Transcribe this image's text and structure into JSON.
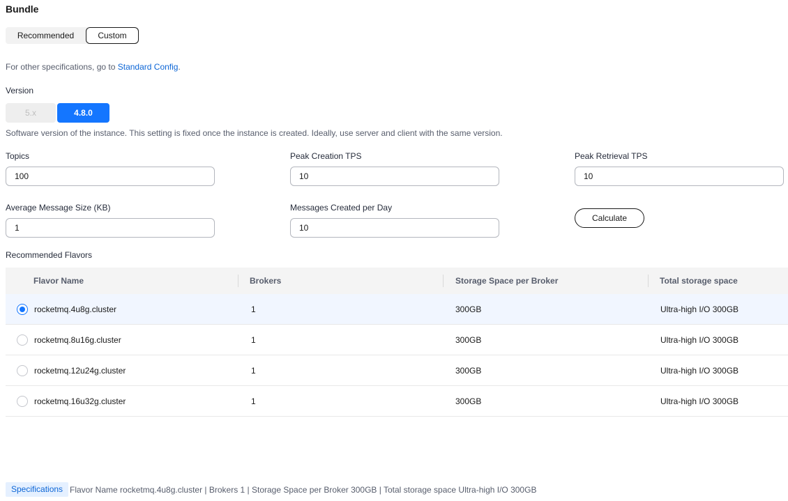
{
  "bundle": {
    "title": "Bundle",
    "tabs": {
      "recommended": "Recommended",
      "custom": "Custom"
    }
  },
  "note": {
    "prefix": "For other specifications, go to ",
    "link": "Standard Config",
    "suffix": "."
  },
  "version": {
    "label": "Version",
    "options": [
      "5.x",
      "4.8.0"
    ],
    "selected": "4.8.0",
    "hint": "Software version of the instance. This setting is fixed once the instance is created. Ideally, use server and client with the same version."
  },
  "inputs": {
    "topics": {
      "label": "Topics",
      "value": "100"
    },
    "peak_creation_tps": {
      "label": "Peak Creation TPS",
      "value": "10"
    },
    "peak_retrieval_tps": {
      "label": "Peak Retrieval TPS",
      "value": "10"
    },
    "avg_message_size": {
      "label": "Average Message Size (KB)",
      "value": "1"
    },
    "messages_per_day": {
      "label": "Messages Created per Day",
      "value": "10"
    }
  },
  "calculate_label": "Calculate",
  "flavors": {
    "label": "Recommended Flavors",
    "columns": [
      "Flavor Name",
      "Brokers",
      "Storage Space per Broker",
      "Total storage space"
    ],
    "rows": [
      {
        "name": "rocketmq.4u8g.cluster",
        "brokers": "1",
        "storage": "300GB",
        "total": "Ultra-high I/O 300GB",
        "selected": true
      },
      {
        "name": "rocketmq.8u16g.cluster",
        "brokers": "1",
        "storage": "300GB",
        "total": "Ultra-high I/O 300GB",
        "selected": false
      },
      {
        "name": "rocketmq.12u24g.cluster",
        "brokers": "1",
        "storage": "300GB",
        "total": "Ultra-high I/O 300GB",
        "selected": false
      },
      {
        "name": "rocketmq.16u32g.cluster",
        "brokers": "1",
        "storage": "300GB",
        "total": "Ultra-high I/O 300GB",
        "selected": false
      }
    ]
  },
  "specifications": {
    "tag": "Specifications",
    "text": "Flavor Name rocketmq.4u8g.cluster | Brokers 1 | Storage Space per Broker 300GB | Total storage space Ultra-high I/O 300GB"
  },
  "colors": {
    "accent": "#1476ff",
    "link": "#0d66d6",
    "selected_row": "#f1f6ff"
  }
}
